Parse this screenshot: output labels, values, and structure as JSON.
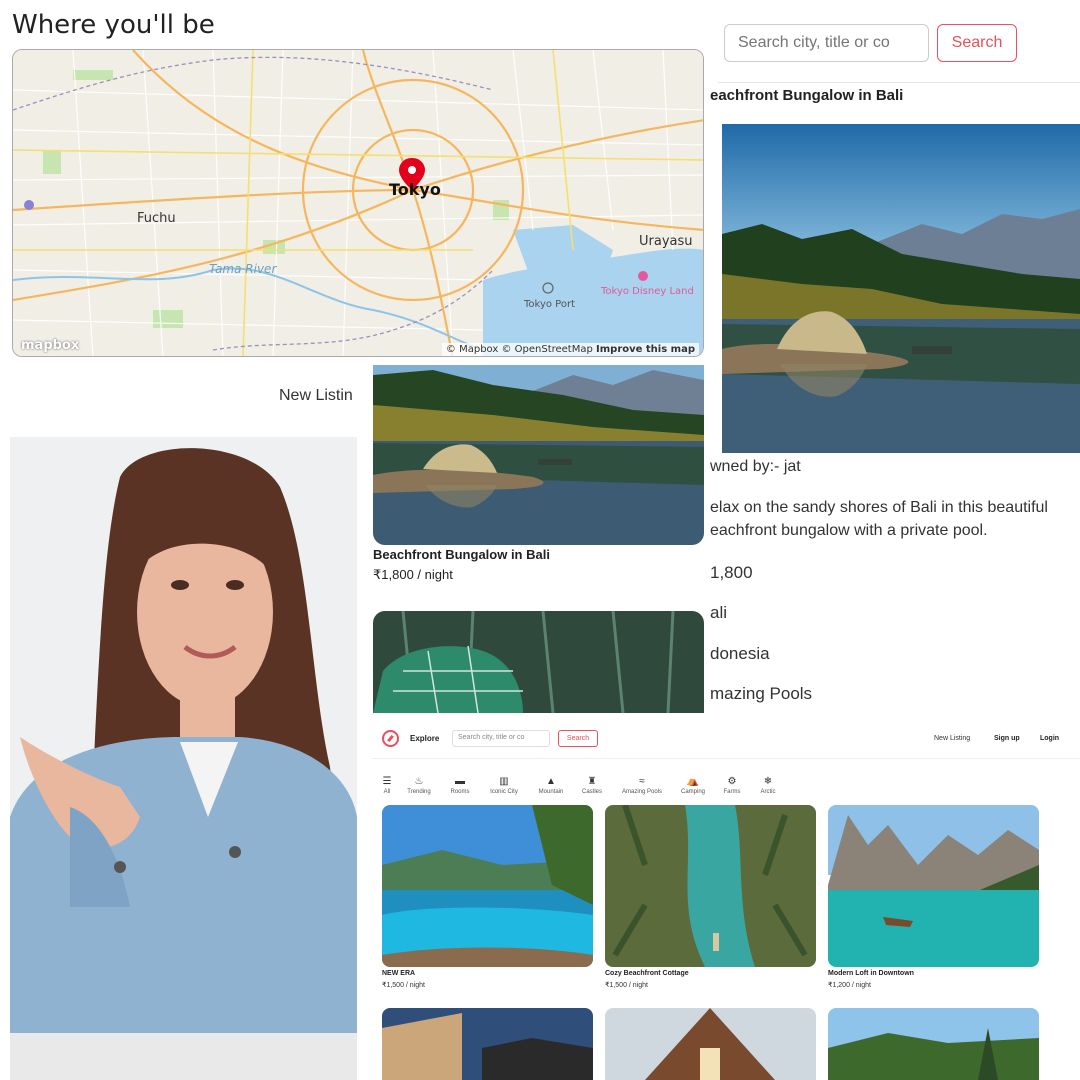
{
  "map": {
    "title": "Where you'll be",
    "labels": {
      "tokyo": "Tokyo",
      "fuchu": "Fuchu",
      "urayasu": "Urayasu",
      "tama_river": "Tama River",
      "tokyo_port": "Tokyo Port",
      "disney": "Tokyo Disney Land"
    },
    "attribution_prefix": "© Mapbox © OpenStreetMap ",
    "attribution_link": "Improve this map",
    "logo": "mapbox",
    "marker_color": "#e3001b"
  },
  "detail": {
    "search_placeholder": "Search city, title or co",
    "search_button": "Search",
    "title": "eachfront Bungalow in Bali",
    "owner": "wned by:- jat",
    "description_line1": "elax on the sandy shores of Bali in this beautiful",
    "description_line2": "eachfront bungalow with a private pool.",
    "price": "1,800",
    "location": "ali",
    "country": "donesia",
    "category": "mazing Pools"
  },
  "listing_panel": {
    "new_listing_partial": "New Listin",
    "card1": {
      "title": "Beachfront Bungalow in Bali",
      "price": "₹1,800 / night"
    }
  },
  "mini_app": {
    "brand_color": "#e8505b",
    "nav": {
      "explore": "Explore",
      "search_placeholder": "Search city, title or co",
      "search_button": "Search",
      "new_listing": "New Listing",
      "signup": "Sign up",
      "login": "Login"
    },
    "filters": [
      {
        "icon": "list-icon",
        "glyph": "☰",
        "label": "All"
      },
      {
        "icon": "fire-icon",
        "glyph": "♨",
        "label": "Trending"
      },
      {
        "icon": "bed-icon",
        "glyph": "▬",
        "label": "Rooms"
      },
      {
        "icon": "city-icon",
        "glyph": "▥",
        "label": "Iconic City"
      },
      {
        "icon": "mountain-icon",
        "glyph": "▲",
        "label": "Mountain"
      },
      {
        "icon": "castle-icon",
        "glyph": "♜",
        "label": "Castles"
      },
      {
        "icon": "pool-icon",
        "glyph": "≈",
        "label": "Amazing Pools"
      },
      {
        "icon": "tent-icon",
        "glyph": "⛺",
        "label": "Camping"
      },
      {
        "icon": "tractor-icon",
        "glyph": "⚙",
        "label": "Farms"
      },
      {
        "icon": "snowflake-icon",
        "glyph": "❄",
        "label": "Arctic"
      }
    ],
    "cards": [
      {
        "title": "NEW ERA",
        "price": "₹1,500 / night"
      },
      {
        "title": "Cozy Beachfront Cottage",
        "price": "₹1,500 / night"
      },
      {
        "title": "Modern Loft in Downtown",
        "price": "₹1,200 / night"
      }
    ]
  }
}
